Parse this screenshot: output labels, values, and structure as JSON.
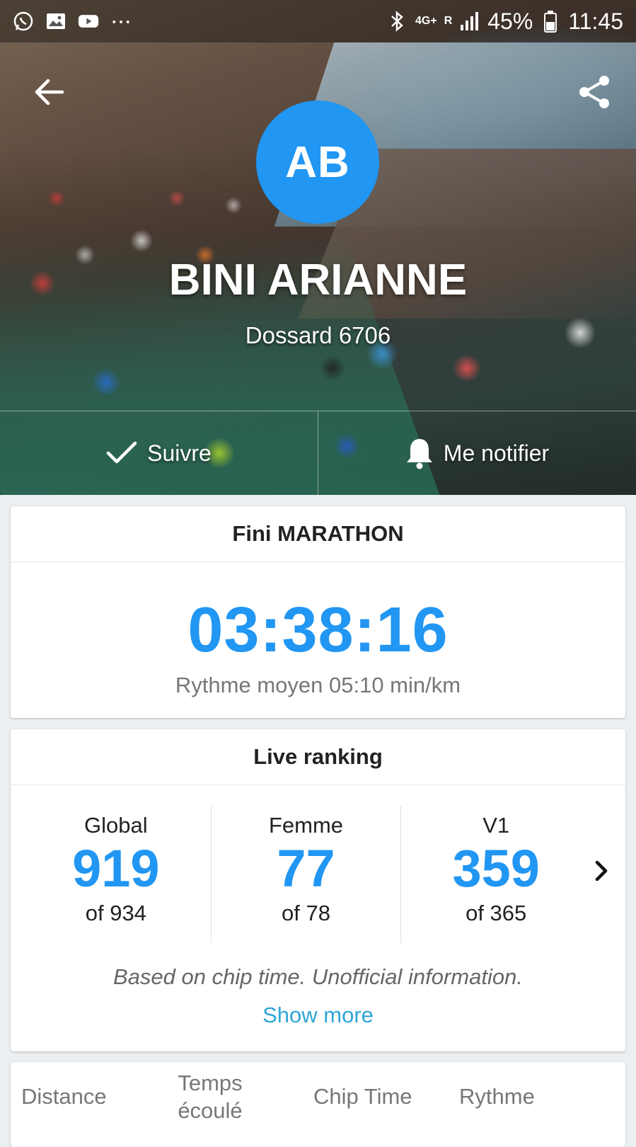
{
  "status_bar": {
    "network": "4G+",
    "roaming": "R",
    "battery": "45%",
    "time": "11:45"
  },
  "header": {
    "avatar_initials": "AB",
    "name": "BINI ARIANNE",
    "bib": "Dossard 6706",
    "follow_label": "Suivre",
    "notify_label": "Me notifier"
  },
  "finish_card": {
    "title": "Fini MARATHON",
    "time": "03:38:16",
    "pace": "Rythme moyen 05:10 min/km"
  },
  "ranking": {
    "title": "Live ranking",
    "columns": [
      {
        "label": "Global",
        "value": "919",
        "of": "of 934"
      },
      {
        "label": "Femme",
        "value": "77",
        "of": "of 78"
      },
      {
        "label": "V1",
        "value": "359",
        "of": "of 365"
      }
    ],
    "disclaimer": "Based on chip time. Unofficial information.",
    "show_more": "Show more"
  },
  "splits": {
    "headers": [
      "Distance",
      "Temps écoulé",
      "Chip Time",
      "Rythme"
    ]
  },
  "colors": {
    "accent": "#2196f3",
    "link": "#2fa6d6"
  }
}
